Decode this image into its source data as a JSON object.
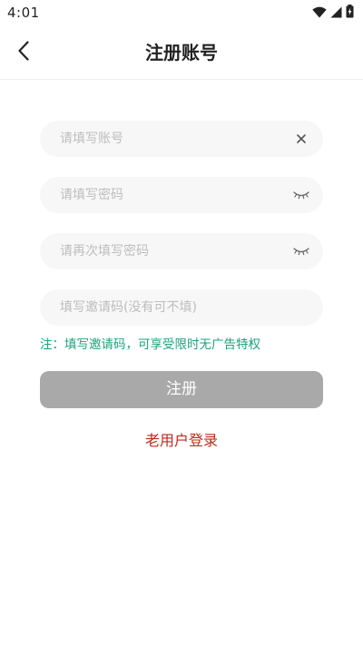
{
  "status_bar": {
    "time": "4:01"
  },
  "header": {
    "title": "注册账号",
    "back_icon": "chevron-left-icon"
  },
  "form": {
    "account_placeholder": "请填写账号",
    "account_value": "",
    "password_placeholder": "请填写密码",
    "password_value": "",
    "confirm_placeholder": "请再次填写密码",
    "confirm_value": "",
    "invite_placeholder": "填写邀请码(没有可不填)",
    "invite_value": "",
    "note": "注：填写邀请码，可享受限时无广告特权",
    "submit_label": "注册",
    "login_link": "老用户登录"
  },
  "colors": {
    "note": "#1aa37a",
    "submit_bg": "#a9a9a9",
    "login_link": "#c0281d",
    "field_bg": "#f7f7f7"
  }
}
